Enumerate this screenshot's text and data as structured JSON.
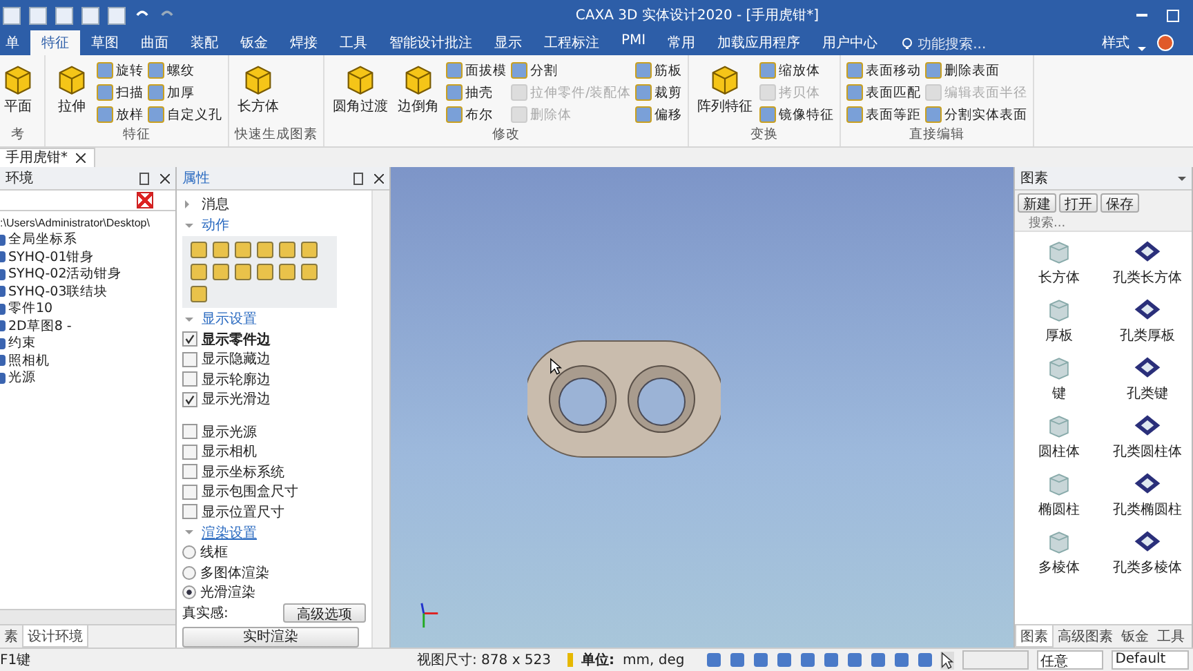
{
  "window": {
    "title": "CAXA 3D 实体设计2020 - [手用虎钳*]"
  },
  "tabs": [
    {
      "label": "单",
      "selected": false
    },
    {
      "label": "特征",
      "selected": true
    },
    {
      "label": "草图",
      "selected": false
    },
    {
      "label": "曲面",
      "selected": false
    },
    {
      "label": "装配",
      "selected": false
    },
    {
      "label": "钣金",
      "selected": false
    },
    {
      "label": "焊接",
      "selected": false
    },
    {
      "label": "工具",
      "selected": false
    },
    {
      "label": "智能设计批注",
      "selected": false
    },
    {
      "label": "显示",
      "selected": false
    },
    {
      "label": "工程标注",
      "selected": false
    },
    {
      "label": "PMI",
      "selected": false
    },
    {
      "label": "常用",
      "selected": false
    },
    {
      "label": "加载应用程序",
      "selected": false
    },
    {
      "label": "用户中心",
      "selected": false
    }
  ],
  "feature_search": {
    "placeholder": "功能搜索..."
  },
  "style_menu": "样式",
  "ribbon": {
    "groups": [
      {
        "label": "考",
        "large": [
          {
            "label": "平面"
          }
        ]
      },
      {
        "label": "特征",
        "large": [
          {
            "label": "拉伸"
          }
        ],
        "columns": [
          [
            {
              "label": "旋转",
              "disabled": false
            },
            {
              "label": "扫描",
              "disabled": false
            },
            {
              "label": "放样",
              "disabled": false
            }
          ],
          [
            {
              "label": "螺纹",
              "disabled": false
            },
            {
              "label": "加厚",
              "disabled": false
            },
            {
              "label": "自定义孔",
              "disabled": false
            }
          ]
        ]
      },
      {
        "label": "快速生成图素",
        "large": [
          {
            "label": "长方体"
          }
        ]
      },
      {
        "label": "修改",
        "large": [
          {
            "label": "圆角过渡"
          },
          {
            "label": "边倒角"
          }
        ],
        "columns": [
          [
            {
              "label": "面拔模",
              "disabled": false
            },
            {
              "label": "抽壳",
              "disabled": false
            },
            {
              "label": "布尔",
              "disabled": false
            }
          ],
          [
            {
              "label": "分割",
              "disabled": false
            },
            {
              "label": "拉伸零件/装配体",
              "disabled": true
            },
            {
              "label": "删除体",
              "disabled": true
            }
          ],
          [
            {
              "label": "筋板",
              "disabled": false
            },
            {
              "label": "裁剪",
              "disabled": false
            },
            {
              "label": "偏移",
              "disabled": false
            }
          ]
        ]
      },
      {
        "label": "变换",
        "large": [
          {
            "label": "阵列特征"
          }
        ],
        "columns": [
          [
            {
              "label": "缩放体",
              "disabled": false
            },
            {
              "label": "拷贝体",
              "disabled": true
            },
            {
              "label": "镜像特征",
              "disabled": false
            }
          ]
        ]
      },
      {
        "label": "直接编辑",
        "columns": [
          [
            {
              "label": "表面移动",
              "disabled": false
            },
            {
              "label": "表面匹配",
              "disabled": false
            },
            {
              "label": "表面等距",
              "disabled": false
            }
          ],
          [
            {
              "label": "删除表面",
              "disabled": false
            },
            {
              "label": "编辑表面半径",
              "disabled": true
            },
            {
              "label": "分割实体表面",
              "disabled": false
            }
          ]
        ]
      }
    ]
  },
  "document_tab": "手用虎钳*",
  "env_panel": {
    "title": "环境",
    "tree": [
      {
        "label": ":\\Users\\Administrator\\Desktop\\",
        "children": [
          {
            "label": "全局坐标系"
          },
          {
            "label": "SYHQ-01钳身"
          },
          {
            "label": "SYHQ-02活动钳身"
          },
          {
            "label": "SYHQ-03联结块"
          },
          {
            "label": "零件10"
          },
          {
            "label": "2D草图8 -"
          },
          {
            "label": "约束"
          },
          {
            "label": "照相机"
          },
          {
            "label": "光源"
          }
        ]
      }
    ],
    "bottom_tabs": [
      {
        "label": "素",
        "selected": false
      },
      {
        "label": "设计环境",
        "selected": true
      }
    ]
  },
  "props_panel": {
    "title": "属性",
    "message": {
      "label": "消息",
      "expanded": false
    },
    "actions": {
      "label": "动作",
      "expanded": true
    },
    "display": {
      "label": "显示设置",
      "expanded": true,
      "items": [
        {
          "label": "显示零件边",
          "checked": true
        },
        {
          "label": "显示隐藏边",
          "checked": false
        },
        {
          "label": "显示轮廓边",
          "checked": false
        },
        {
          "label": "显示光滑边",
          "checked": true
        }
      ],
      "items2": [
        {
          "label": "显示光源",
          "checked": false
        },
        {
          "label": "显示相机",
          "checked": false
        },
        {
          "label": "显示坐标系统",
          "checked": false
        },
        {
          "label": "显示包围盒尺寸",
          "checked": false
        },
        {
          "label": "显示位置尺寸",
          "checked": false
        }
      ]
    },
    "render": {
      "label": "渲染设置",
      "expanded": true,
      "options": [
        {
          "label": "线框",
          "selected": false
        },
        {
          "label": "多图体渲染",
          "selected": false
        },
        {
          "label": "光滑渲染",
          "selected": true
        }
      ]
    },
    "realism_label": "真实感:",
    "advanced_button": "高级选项",
    "realtime_button": "实时渲染"
  },
  "catalog_panel": {
    "title": "图素",
    "buttons": [
      "新建",
      "打开",
      "保存"
    ],
    "search": {
      "placeholder": "搜索..."
    },
    "items": [
      {
        "label": "长方体",
        "kind": "solid"
      },
      {
        "label": "孔类长方体",
        "kind": "hole"
      },
      {
        "label": "厚板",
        "kind": "solid"
      },
      {
        "label": "孔类厚板",
        "kind": "hole"
      },
      {
        "label": "键",
        "kind": "solid"
      },
      {
        "label": "孔类键",
        "kind": "hole"
      },
      {
        "label": "圆柱体",
        "kind": "solid"
      },
      {
        "label": "孔类圆柱体",
        "kind": "hole"
      },
      {
        "label": "椭圆柱",
        "kind": "solid"
      },
      {
        "label": "孔类椭圆柱",
        "kind": "hole"
      },
      {
        "label": "多棱体",
        "kind": "solid"
      },
      {
        "label": "孔类多棱体",
        "kind": "hole"
      }
    ],
    "bottom_tabs": [
      {
        "label": "图素",
        "selected": true
      },
      {
        "label": "高级图素",
        "selected": false
      },
      {
        "label": "钣金",
        "selected": false
      },
      {
        "label": "工具",
        "selected": false
      }
    ]
  },
  "status_bar": {
    "hint": "F1键",
    "view_size": "视图尺寸: 878 x 523",
    "unit_label": "单位:",
    "unit_value": "mm, deg",
    "filter": "任意",
    "style": "Default"
  }
}
